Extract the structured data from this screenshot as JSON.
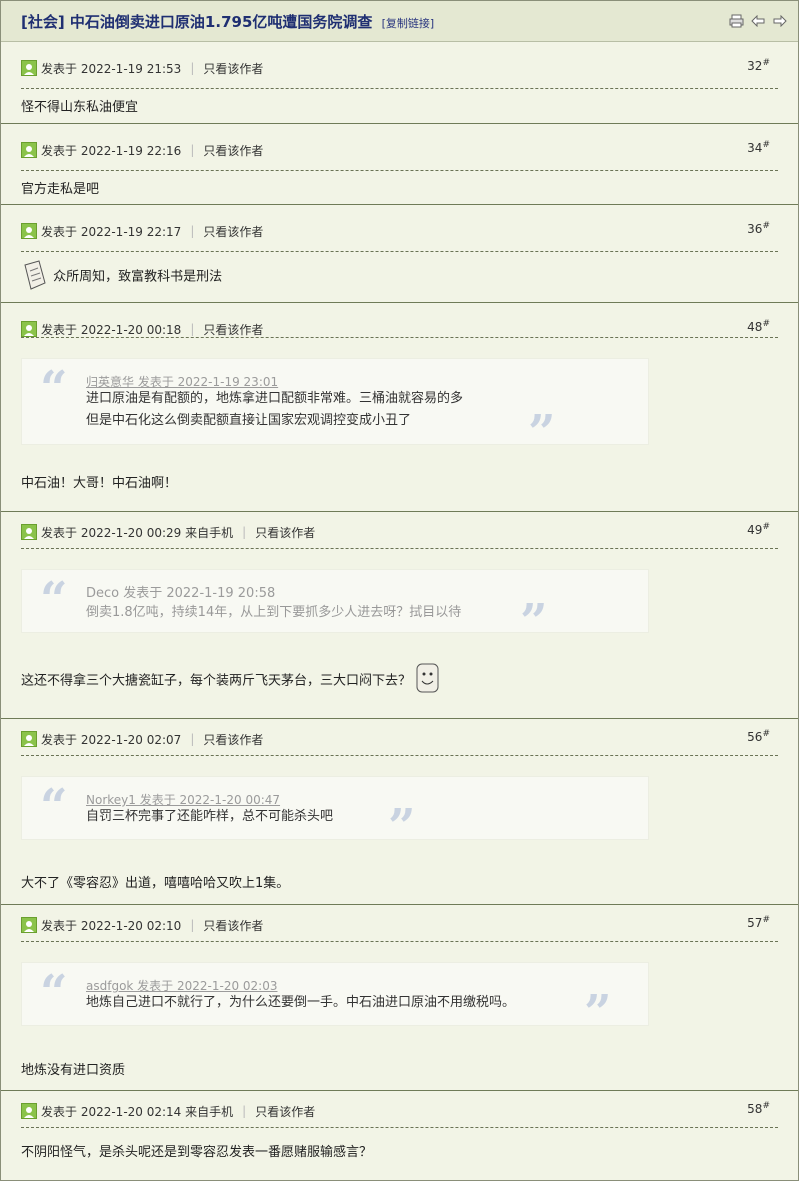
{
  "header": {
    "title": "[社会] 中石油倒卖进口原油1.795亿吨遭国务院调查",
    "copy_link": "[复制链接]",
    "icons": [
      "print-icon",
      "arrow-left-icon",
      "arrow-right-icon"
    ]
  },
  "common": {
    "only_author": "只看该作者"
  },
  "posts": [
    {
      "meta": "发表于 2022-1-19 21:53",
      "floor": "32",
      "text": "怪不得山东私油便宜"
    },
    {
      "meta": "发表于 2022-1-19 22:16",
      "floor": "34",
      "text": "官方走私是吧"
    },
    {
      "meta": "发表于 2022-1-19 22:17",
      "floor": "36",
      "text": "众所周知，致富教科书是刑法"
    },
    {
      "meta": "发表于 2022-1-20 00:18",
      "floor": "48",
      "quote": {
        "author": "归英意华 发表于 2022-1-19 23:01",
        "lines": [
          "进口原油是有配额的，地炼拿进口配额非常难。三桶油就容易的多",
          "但是中石化这么倒卖配额直接让国家宏观调控变成小丑了"
        ]
      },
      "text": "中石油！大哥！中石油啊！"
    },
    {
      "meta": "发表于 2022-1-20 00:29 来自手机",
      "floor": "49",
      "quote": {
        "author": "Deco 发表于 2022-1-19 20:58",
        "lines": [
          "倒卖1.8亿吨，持续14年，从上到下要抓多少人进去呀？拭目以待"
        ]
      },
      "text": "这还不得拿三个大搪瓷缸子，每个装两斤飞天茅台，三大口闷下去？"
    },
    {
      "meta": "发表于 2022-1-20 02:07",
      "floor": "56",
      "quote": {
        "author": "Norkey1 发表于 2022-1-20 00:47",
        "lines": [
          "自罚三杯完事了还能咋样，总不可能杀头吧"
        ]
      },
      "text": "大不了《零容忍》出道，嘻嘻哈哈又吹上1集。"
    },
    {
      "meta": "发表于 2022-1-20 02:10",
      "floor": "57",
      "quote": {
        "author": "asdfgok 发表于 2022-1-20 02:03",
        "lines": [
          "地炼自己进口不就行了，为什么还要倒一手。中石油进口原油不用缴税吗。"
        ]
      },
      "text": "地炼没有进口资质"
    },
    {
      "meta": "发表于 2022-1-20 02:14 来自手机",
      "floor": "58",
      "text": "不阴阳怪气，是杀头呢还是到零容忍发表一番愿赌服输感言？"
    }
  ]
}
